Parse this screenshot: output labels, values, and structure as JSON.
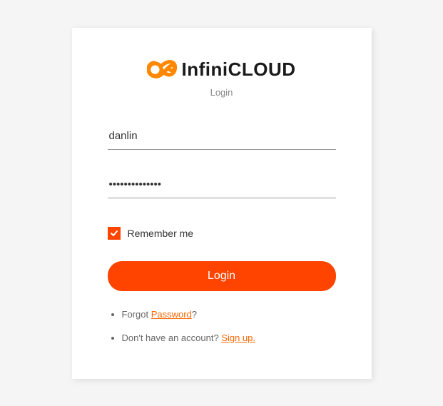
{
  "brand": {
    "name": "InfiniCLOUD",
    "subtitle": "Login",
    "accent_color": "#ff4400"
  },
  "form": {
    "username_value": "danlin",
    "password_value": "••••••••••••••",
    "remember_label": "Remember me",
    "remember_checked": true,
    "submit_label": "Login"
  },
  "links": {
    "forgot_prefix": "Forgot ",
    "forgot_link": "Password",
    "forgot_suffix": "?",
    "signup_prefix": "Don't have an account? ",
    "signup_link": "Sign up."
  }
}
